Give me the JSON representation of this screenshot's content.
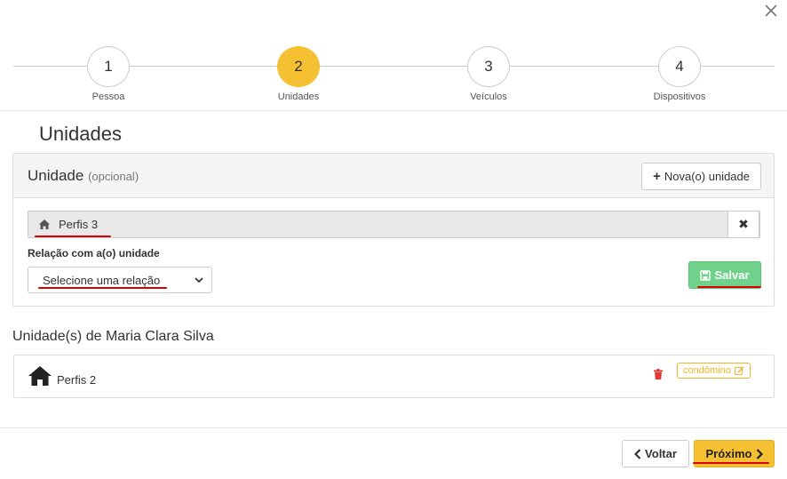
{
  "colors": {
    "accent": "#f6c033",
    "success": "#6fd18a",
    "danger": "#e53935",
    "badge": "#f0b429",
    "annotation": "#dd0000"
  },
  "close_icon": "close-icon",
  "stepper": {
    "steps": [
      {
        "number": "1",
        "label": "Pessoa",
        "active": false
      },
      {
        "number": "2",
        "label": "Unidades",
        "active": true
      },
      {
        "number": "3",
        "label": "Veículos",
        "active": false
      },
      {
        "number": "4",
        "label": "Dispositivos",
        "active": false
      }
    ]
  },
  "section": {
    "title": "Unidades"
  },
  "unit_panel": {
    "title": "Unidade",
    "optional": "(opcional)",
    "new_button": "Nova(o) unidade",
    "selected_unit": "Perfis 3",
    "relation_label": "Relação com a(o) unidade",
    "relation_select": "Selecione uma relação",
    "save_button": "Salvar"
  },
  "unit_list": {
    "title": "Unidade(s) de Maria Clara Silva",
    "items": [
      {
        "name": "Perfis 2",
        "badge": "condômino"
      }
    ]
  },
  "footer": {
    "back_button": "Voltar",
    "next_button": "Próximo"
  }
}
